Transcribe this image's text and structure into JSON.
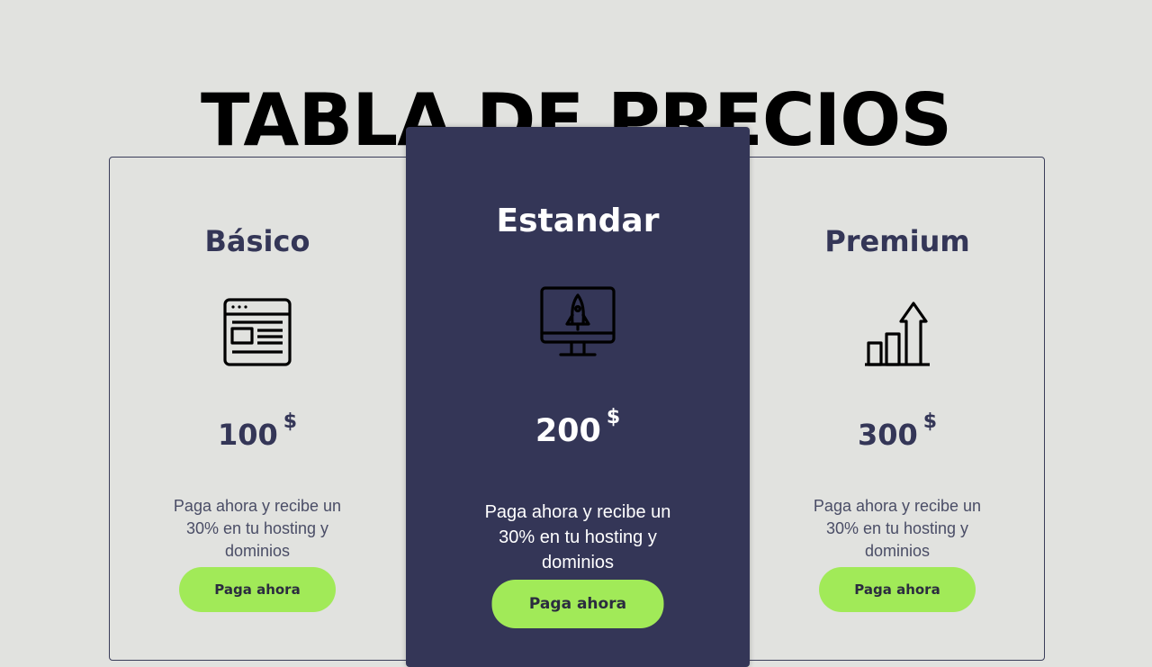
{
  "header": {
    "title": "TABLA DE PRECIOS"
  },
  "plans": [
    {
      "name": "Básico",
      "icon": "browser-window-icon",
      "price": "100",
      "currency": "$",
      "description": "Paga ahora y recibe un 30% en tu hosting y dominios",
      "button_label": "Paga ahora"
    },
    {
      "name": "Estandar",
      "icon": "rocket-monitor-icon",
      "price": "200",
      "currency": "$",
      "description": "Paga ahora y recibe un 30% en tu hosting y dominios",
      "button_label": "Paga ahora"
    },
    {
      "name": "Premium",
      "icon": "growth-chart-icon",
      "price": "300",
      "currency": "$",
      "description": "Paga ahora y recibe un 30% en tu hosting y dominios",
      "button_label": "Paga ahora"
    }
  ],
  "colors": {
    "background": "#e1e2df",
    "featured_card": "#343657",
    "accent_button": "#a1ea58",
    "text_dark": "#343657"
  }
}
